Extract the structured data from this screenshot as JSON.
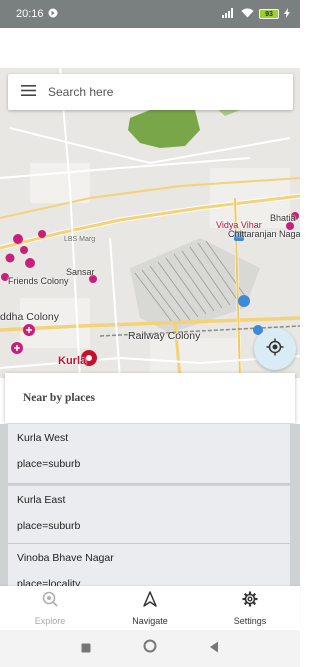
{
  "status_bar": {
    "time": "20:16",
    "battery": "93"
  },
  "search": {
    "placeholder": "Search here"
  },
  "map": {
    "labels": {
      "vidya_vihar": "Vidya Vihar",
      "chittaranjan": "Chittaranjan Nagar",
      "bhatia": "Bhatia",
      "friends_colony": "Friends Colony",
      "sansar": "Sansar",
      "buddha_colony": "ddha Colony",
      "railway_colony": "Railway Colony",
      "kurla": "Kurla",
      "lbs_marg": "LBS Marg"
    }
  },
  "nearby": {
    "title": "Near by places",
    "places": [
      {
        "name": "Kurla West",
        "type": "place=suburb"
      },
      {
        "name": "Kurla East",
        "type": "place=suburb"
      },
      {
        "name": "Vinoba Bhave Nagar",
        "type": "place=locality"
      }
    ]
  },
  "bottom_nav": {
    "items": [
      {
        "label": "Explore",
        "icon": "explore-icon",
        "active": false
      },
      {
        "label": "Navigate",
        "icon": "navigate-icon",
        "active": true
      },
      {
        "label": "Settings",
        "icon": "gear-icon",
        "active": true
      }
    ]
  },
  "colors": {
    "status_bar": "#7a7f80",
    "list_panel": "#cfd2d3",
    "list_item": "#ebecef",
    "locate_button": "#d9ecf5",
    "kurla_marker": "#c4102d"
  }
}
